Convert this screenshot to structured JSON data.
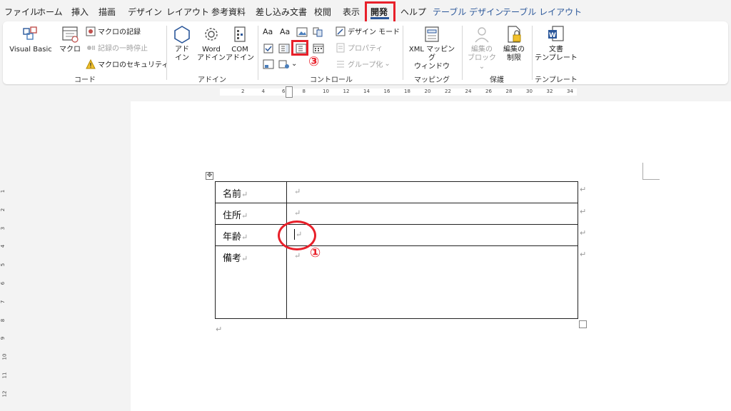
{
  "tabs": [
    "ファイル",
    "ホーム",
    "挿入",
    "描画",
    "デザイン",
    "レイアウト",
    "参考資料",
    "差し込み文書",
    "校閲",
    "表示",
    "開発",
    "ヘルプ",
    "テーブル デザイン",
    "テーブル レイアウト"
  ],
  "active_tab": "開発",
  "markers": {
    "one": "①",
    "two": "②",
    "three": "③"
  },
  "ribbon": {
    "code": {
      "label": "コード",
      "visual_basic": "Visual Basic",
      "macro": "マクロ",
      "record_macro": "マクロの記録",
      "pause_recording": "記録の一時停止",
      "macro_security": "マクロのセキュリティ"
    },
    "addins": {
      "label": "アドイン",
      "addin": [
        "アド",
        "イン"
      ],
      "word_addin": [
        "Word",
        "アドイン"
      ],
      "com_addin": [
        "COM",
        "アドイン"
      ]
    },
    "controls": {
      "label": "コントロール",
      "rich_text": "Aa",
      "plain_text": "Aa",
      "design_mode": "デザイン モード",
      "properties": "プロパティ",
      "group": "グループ化"
    },
    "mapping": {
      "label": "マッピング",
      "xml_pane": [
        "XML マッピング",
        "ウィンドウ"
      ]
    },
    "protect": {
      "label": "保護",
      "block_authors": [
        "編集の",
        "ブロック"
      ],
      "restrict_editing": [
        "編集の",
        "制限"
      ]
    },
    "templates": {
      "label": "テンプレート",
      "document_template": [
        "文書",
        "テンプレート"
      ]
    }
  },
  "ruler": {
    "numbers": [
      "2",
      "4",
      "6",
      "8",
      "10",
      "12",
      "14",
      "16",
      "18",
      "20",
      "22",
      "24",
      "26",
      "28",
      "30",
      "32",
      "34"
    ],
    "vnumbers": [
      "1",
      "2",
      "3",
      "4",
      "5",
      "6",
      "7",
      "8",
      "9",
      "10",
      "11",
      "12"
    ]
  },
  "table": {
    "rows": [
      {
        "label": "名前"
      },
      {
        "label": "住所"
      },
      {
        "label": "年齢"
      },
      {
        "label": "備考"
      }
    ],
    "mark": "↵"
  },
  "colors": {
    "accent": "#2b579a",
    "highlight": "#e8202a"
  }
}
